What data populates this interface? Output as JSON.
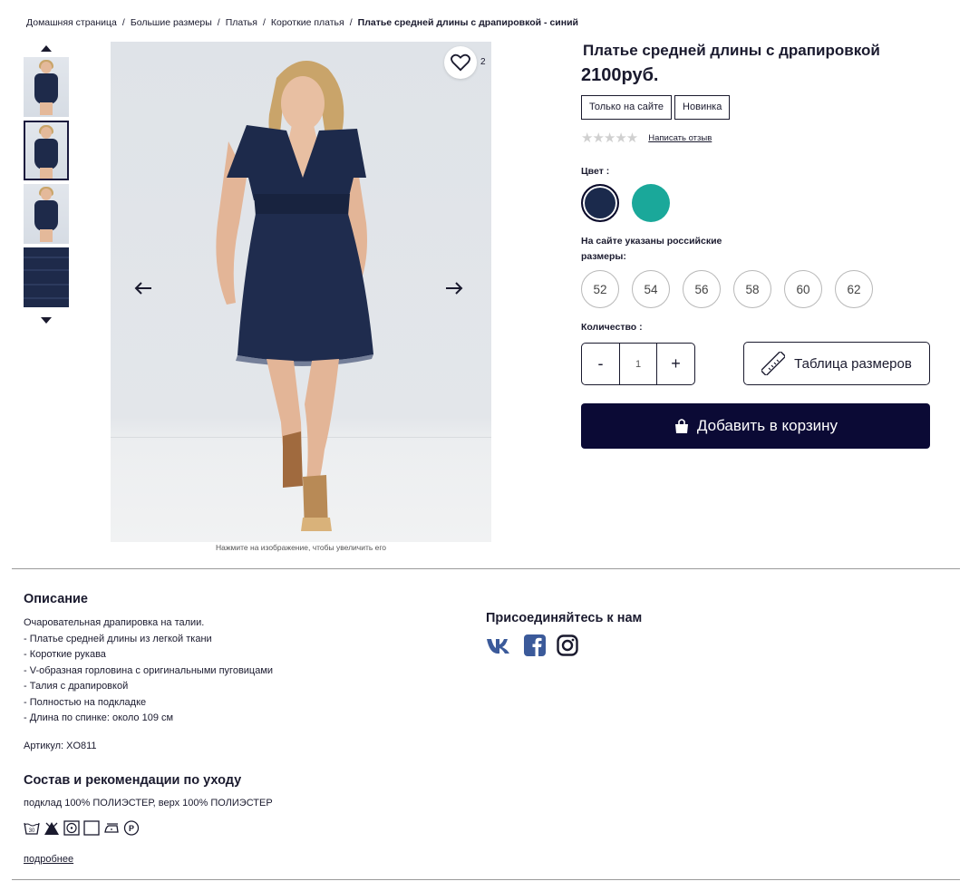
{
  "breadcrumb": {
    "items": [
      "Домашняя страница",
      "Большие размеры",
      "Платья",
      "Короткие платья"
    ],
    "current": "Платье средней длины с драпировкой - синий"
  },
  "gallery": {
    "wishlist_count": "2",
    "zoom_note": "Нажмите на изображение, чтобы увеличить его"
  },
  "product": {
    "title": "Платье средней длины с драпировкой",
    "price": "2100руб.",
    "badges": [
      "Только на сайте",
      "Новинка"
    ],
    "rating_stars": "★★★★★",
    "review_link": "Написать отзыв",
    "color_label": "Цвет :",
    "colors": [
      {
        "name": "navy",
        "hex": "#1b2a4c",
        "selected": true
      },
      {
        "name": "teal",
        "hex": "#1aa89a",
        "selected": false
      }
    ],
    "size_note": "На сайте указаны российские размеры:",
    "sizes": [
      "52",
      "54",
      "56",
      "58",
      "60",
      "62"
    ],
    "qty_label": "Количество :",
    "qty_minus": "-",
    "qty_plus": "+",
    "qty_value": "1",
    "size_table": "Таблица размеров",
    "add_to_cart": "Добавить в корзину"
  },
  "description": {
    "heading": "Описание",
    "lines": [
      "Очаровательная драпировка на талии.",
      "- Платье средней длины из легкой ткани",
      "- Короткие рукава",
      "- V-образная горловина с оригинальными пуговицами",
      "- Талия с драпировкой",
      "- Полностью на подкладке",
      "- Длина по спинке: около 109 см"
    ],
    "sku": "Артикул: XO811"
  },
  "care": {
    "heading": "Состав и рекомендации по уходу",
    "composition": "подклад 100% ПОЛИЭСТЕР, верх 100% ПОЛИЭСТЕР",
    "icons": [
      "wash-30-icon",
      "no-bleach-icon",
      "tumble-dry-icon",
      "dry-flat-icon",
      "iron-low-icon",
      "dry-clean-p-icon"
    ],
    "more_link": "подробнее"
  },
  "social": {
    "heading": "Присоединяйтесь к нам",
    "icons": [
      "vk-icon",
      "facebook-icon",
      "instagram-icon"
    ],
    "brand_color": "#3b5a9a"
  },
  "colors": {
    "primary": "#0b0a35",
    "text": "#1a1a2e"
  }
}
